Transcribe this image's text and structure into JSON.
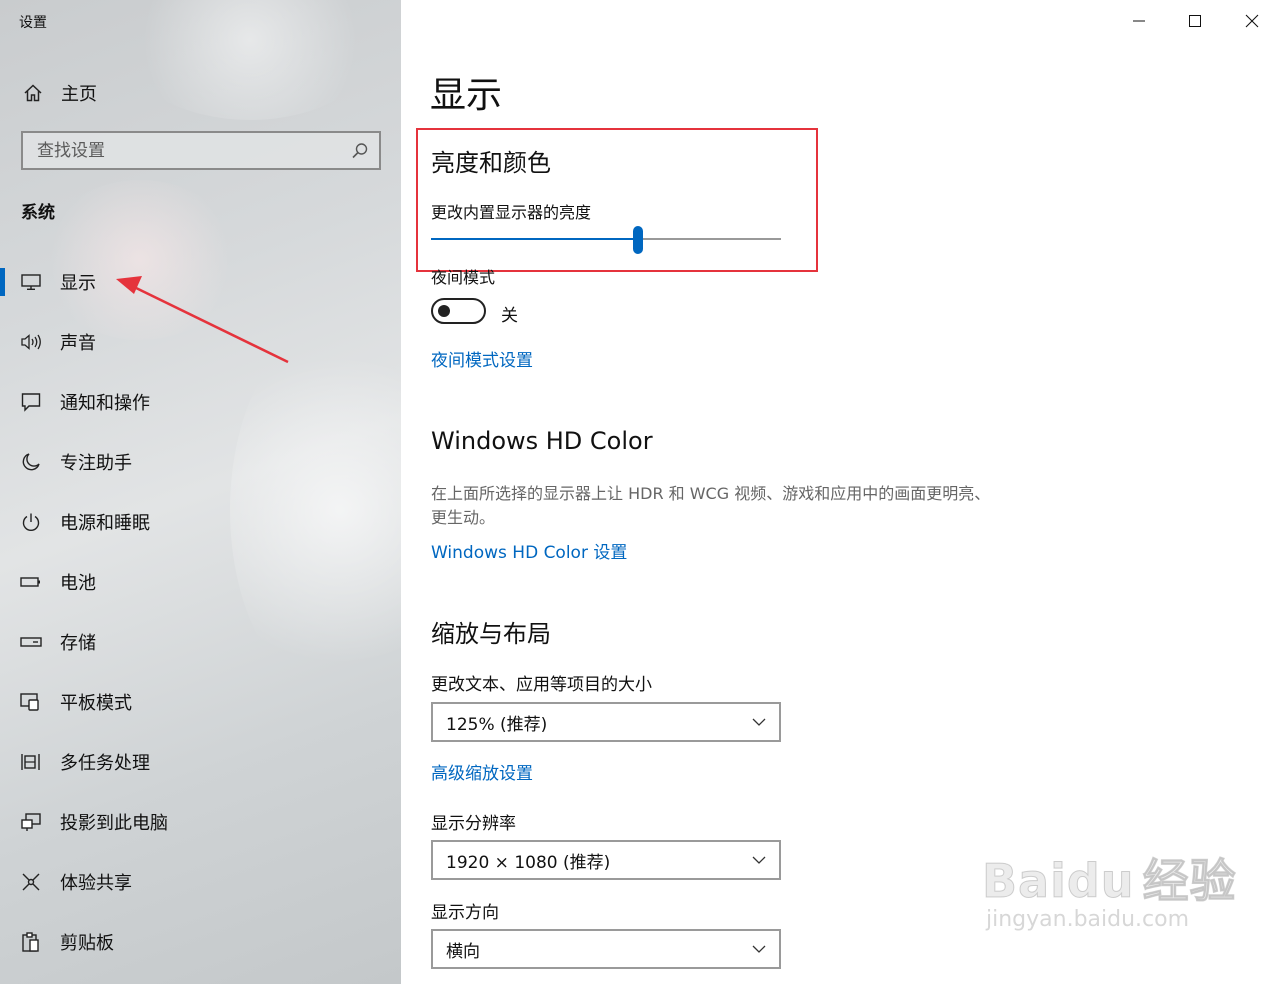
{
  "window": {
    "title": "设置",
    "controls": [
      "minimize",
      "maximize",
      "close"
    ]
  },
  "sidebar": {
    "home_label": "主页",
    "search_placeholder": "查找设置",
    "section_title": "系统",
    "items": [
      {
        "label": "显示",
        "icon": "monitor-icon",
        "active": true
      },
      {
        "label": "声音",
        "icon": "speaker-icon"
      },
      {
        "label": "通知和操作",
        "icon": "notification-icon"
      },
      {
        "label": "专注助手",
        "icon": "moon-icon"
      },
      {
        "label": "电源和睡眠",
        "icon": "power-icon"
      },
      {
        "label": "电池",
        "icon": "battery-icon"
      },
      {
        "label": "存储",
        "icon": "storage-icon"
      },
      {
        "label": "平板模式",
        "icon": "tablet-icon"
      },
      {
        "label": "多任务处理",
        "icon": "multitask-icon"
      },
      {
        "label": "投影到此电脑",
        "icon": "project-icon"
      },
      {
        "label": "体验共享",
        "icon": "share-icon"
      },
      {
        "label": "剪贴板",
        "icon": "clipboard-icon"
      }
    ]
  },
  "main": {
    "page_title": "显示",
    "brightness": {
      "heading": "亮度和颜色",
      "slider_label": "更改内置显示器的亮度",
      "value": 0.59
    },
    "night_mode": {
      "label": "夜间模式",
      "state_label": "关",
      "on": false,
      "settings_link": "夜间模式设置"
    },
    "hd_color": {
      "heading": "Windows HD Color",
      "description": "在上面所选择的显示器上让 HDR 和 WCG 视频、游戏和应用中的画面更明亮、更生动。",
      "link": "Windows HD Color 设置"
    },
    "scale_layout": {
      "heading": "缩放与布局",
      "scale_label": "更改文本、应用等项目的大小",
      "scale_value": "125% (推荐)",
      "advanced_link": "高级缩放设置",
      "resolution_label": "显示分辨率",
      "resolution_value": "1920 × 1080 (推荐)",
      "orientation_label": "显示方向",
      "orientation_value": "横向"
    }
  },
  "watermark": {
    "brand": "Bai",
    "brand2": "du",
    "cn": "经验",
    "url": "jingyan.baidu.com"
  },
  "colors": {
    "accent": "#0067c0",
    "highlight_box": "#e5333c",
    "annotation_arrow": "#e5333c"
  }
}
